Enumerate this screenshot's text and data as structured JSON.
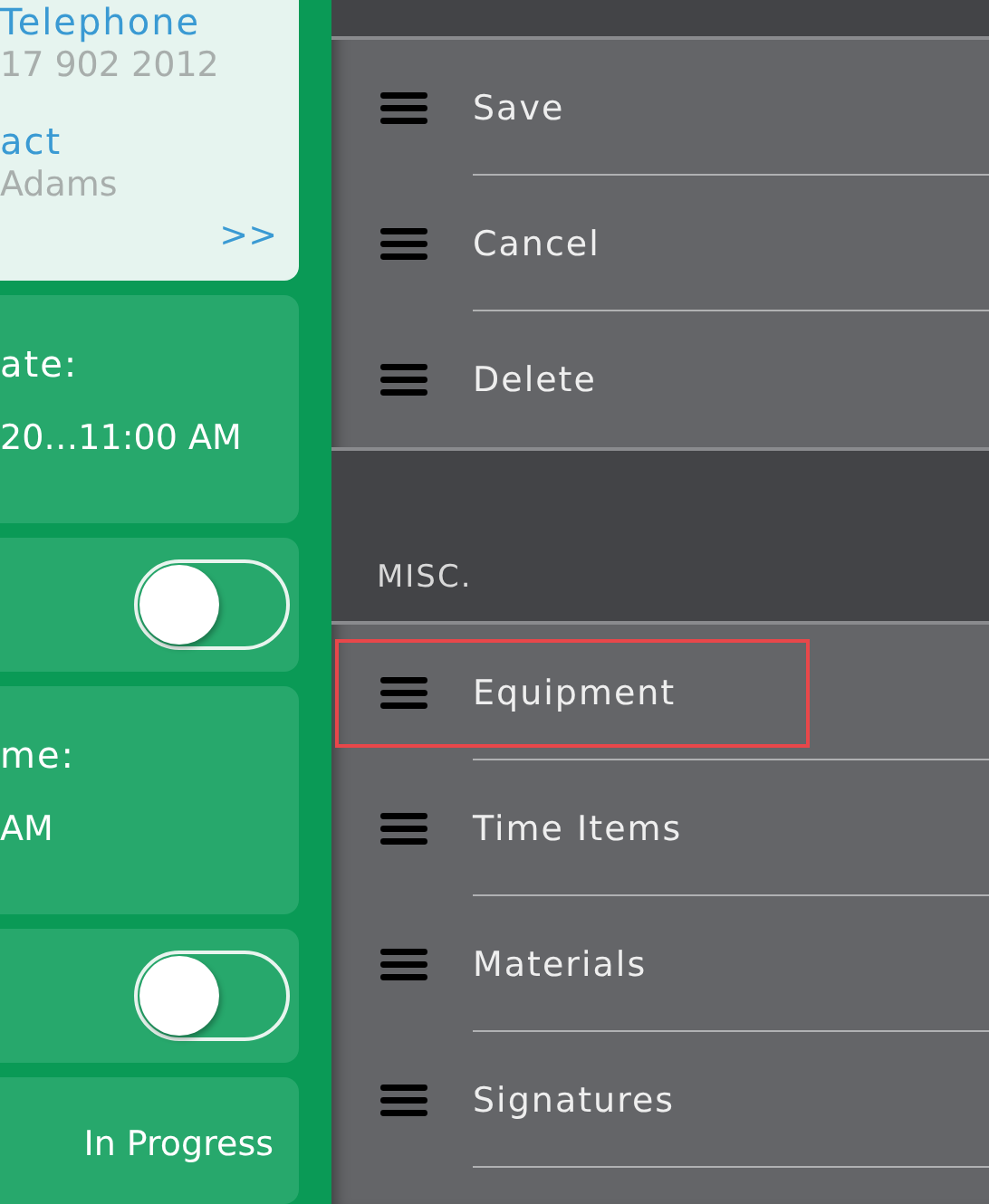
{
  "details": {
    "contact_card": {
      "telephone_label": "Telephone",
      "telephone": "17 902 2012",
      "contact_label": "act",
      "contact": "Adams",
      "more": ">>"
    },
    "rows": [
      {
        "kind": "field",
        "label": "ate:",
        "value": "20…11:00 AM"
      },
      {
        "kind": "toggle",
        "on": false
      },
      {
        "kind": "field",
        "label": "me:",
        "value": "AM"
      },
      {
        "kind": "toggle",
        "on": false
      },
      {
        "kind": "status",
        "value": "In Progress"
      }
    ]
  },
  "menu": {
    "sections": [
      {
        "items": [
          {
            "label": "Save",
            "highlighted": false
          },
          {
            "label": "Cancel",
            "highlighted": false
          },
          {
            "label": "Delete",
            "highlighted": false
          }
        ]
      },
      {
        "title": "MISC.",
        "items": [
          {
            "label": "Equipment",
            "highlighted": true
          },
          {
            "label": "Time Items",
            "highlighted": false
          },
          {
            "label": "Materials",
            "highlighted": false
          },
          {
            "label": "Signatures",
            "highlighted": false
          }
        ]
      }
    ]
  }
}
